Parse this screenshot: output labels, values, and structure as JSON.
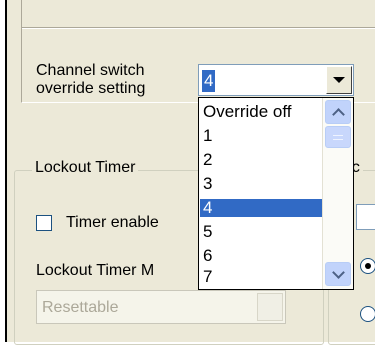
{
  "channel_switch": {
    "label": "Channel switch\noverride setting",
    "selected_value": "4",
    "options": [
      "Override off",
      "1",
      "2",
      "3",
      "4",
      "5",
      "6",
      "7"
    ],
    "selected_index": 4
  },
  "lockout_timer": {
    "title": "Lockout Timer",
    "timer_enable_label": "Timer enable",
    "mode_label": "Lockout Timer M",
    "mode_value": "Resettable"
  },
  "right_group": {
    "title": "uc"
  },
  "colors": {
    "selection": "#316ac5",
    "panel": "#ece9d8",
    "scrollbar": "#c1d3fb"
  }
}
